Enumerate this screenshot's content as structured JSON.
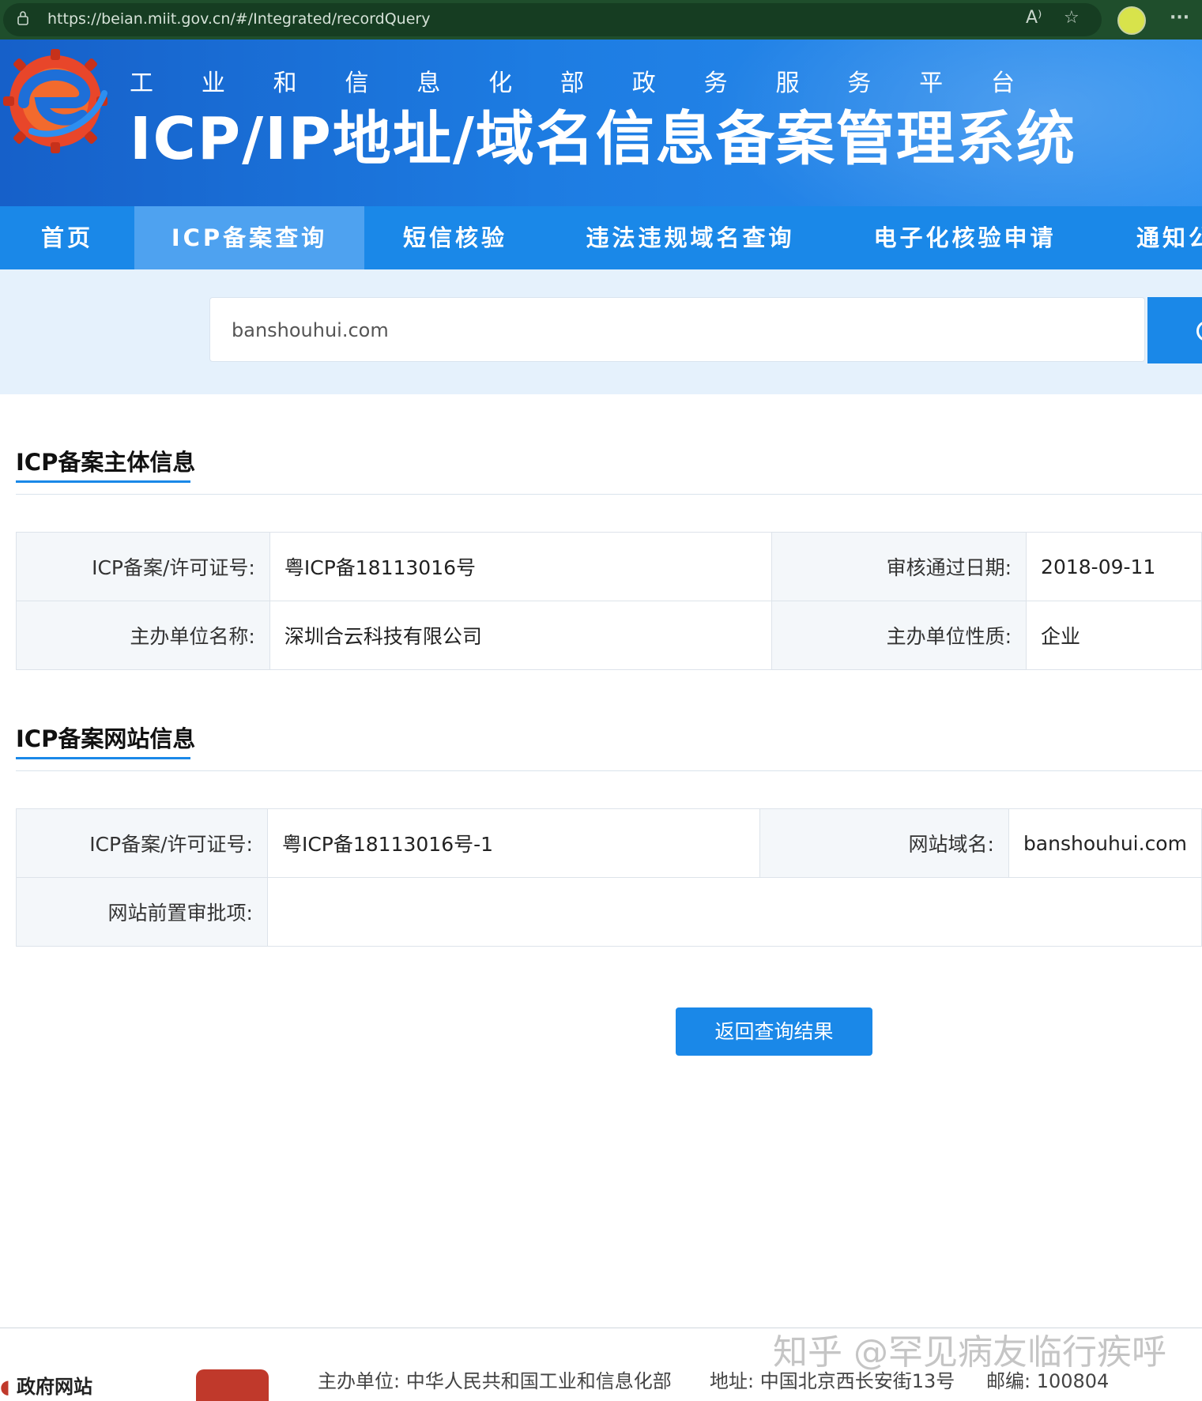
{
  "browser": {
    "url": "https://beian.miit.gov.cn/#/Integrated/recordQuery",
    "read_aloud_icon": "A⁾",
    "favorite_icon": "☆",
    "menu_icon": "···"
  },
  "header": {
    "subtitle_chars": [
      "工",
      "业",
      "和",
      "信",
      "息",
      "化",
      "部",
      "政",
      "务",
      "服",
      "务",
      "平",
      "台"
    ],
    "title": "ICP/IP地址/域名信息备案管理系统"
  },
  "nav": {
    "items": [
      {
        "label": "首页"
      },
      {
        "label": "ICP备案查询"
      },
      {
        "label": "短信核验"
      },
      {
        "label": "违法违规域名查询"
      },
      {
        "label": "电子化核验申请"
      },
      {
        "label": "通知公"
      }
    ],
    "active_index": 1
  },
  "search": {
    "value": "banshouhui.com"
  },
  "subject_section": {
    "title": "ICP备案主体信息",
    "rows": [
      {
        "label1": "ICP备案/许可证号:",
        "value1": "粤ICP备18113016号",
        "label2": "审核通过日期:",
        "value2": "2018-09-11"
      },
      {
        "label1": "主办单位名称:",
        "value1": "深圳合云科技有限公司",
        "label2": "主办单位性质:",
        "value2": "企业"
      }
    ]
  },
  "website_section": {
    "title": "ICP备案网站信息",
    "row1": {
      "label1": "ICP备案/许可证号:",
      "value1": "粤ICP备18113016号-1",
      "label2": "网站域名:",
      "value2": "banshouhui.com"
    },
    "row2": {
      "label": "网站前置审批项:",
      "value": ""
    }
  },
  "back_button": "返回查询结果",
  "footer": {
    "gov_site": "政府网站",
    "sponsor": "主办单位:  中华人民共和国工业和信息化部",
    "address": "地址: 中国北京西长安街13号",
    "postcode": "邮编: 100804"
  },
  "watermark": "知乎 @罕见病友临行疾呼",
  "colors": {
    "primary": "#1a88e8",
    "nav_active": "#4ea2f0",
    "banner_dark": "#1660c9"
  }
}
